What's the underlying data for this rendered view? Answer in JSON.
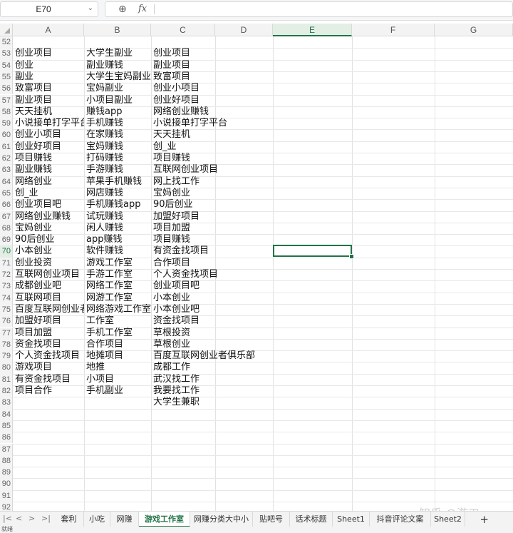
{
  "formula_bar": {
    "cell_reference": "E70",
    "fx_label": "fx",
    "formula_value": ""
  },
  "columns": [
    "A",
    "B",
    "C",
    "D",
    "E",
    "F",
    "G"
  ],
  "selected_column": "E",
  "selected_row": 70,
  "row_numbers": [
    52,
    53,
    54,
    55,
    56,
    57,
    58,
    59,
    60,
    61,
    62,
    63,
    64,
    65,
    66,
    67,
    68,
    69,
    70,
    71,
    72,
    73,
    74,
    75,
    76,
    77,
    78,
    79,
    80,
    81,
    82,
    83,
    84,
    85,
    86,
    87,
    88,
    89,
    90,
    91,
    92
  ],
  "rows": [
    {
      "row": 53,
      "a": "创业项目",
      "b": "大学生副业",
      "c": "创业项目"
    },
    {
      "row": 54,
      "a": "创业",
      "b": "副业赚钱",
      "c": "副业项目"
    },
    {
      "row": 55,
      "a": "副业",
      "b": "大学生宝妈副业",
      "c": "致富项目"
    },
    {
      "row": 56,
      "a": "致富项目",
      "b": "宝妈副业",
      "c": "创业小项目"
    },
    {
      "row": 57,
      "a": "副业项目",
      "b": "小项目副业",
      "c": "创业好项目"
    },
    {
      "row": 58,
      "a": "天天挂机",
      "b": "赚钱app",
      "c": "网络创业赚钱"
    },
    {
      "row": 59,
      "a": "小说接单打字平台",
      "b": "手机赚钱",
      "c": "小说接单打字平台"
    },
    {
      "row": 60,
      "a": "创业小项目",
      "b": "在家赚钱",
      "c": "天天挂机"
    },
    {
      "row": 61,
      "a": "创业好项目",
      "b": "宝妈赚钱",
      "c": "创_业"
    },
    {
      "row": 62,
      "a": "项目赚钱",
      "b": "打码赚钱",
      "c": "项目赚钱"
    },
    {
      "row": 63,
      "a": "副业赚钱",
      "b": "手游赚钱",
      "c": "互联网创业项目"
    },
    {
      "row": 64,
      "a": "网络创业",
      "b": "苹果手机赚钱",
      "c": "网上找工作"
    },
    {
      "row": 65,
      "a": "创_业",
      "b": "网店赚钱",
      "c": "宝妈创业"
    },
    {
      "row": 66,
      "a": "创业项目吧",
      "b": "手机赚钱app",
      "c": "90后创业"
    },
    {
      "row": 67,
      "a": "网络创业赚钱",
      "b": "试玩赚钱",
      "c": "加盟好项目"
    },
    {
      "row": 68,
      "a": "宝妈创业",
      "b": "闲人赚钱",
      "c": "项目加盟"
    },
    {
      "row": 69,
      "a": "90后创业",
      "b": "app赚钱",
      "c": "项目赚钱"
    },
    {
      "row": 70,
      "a": "小本创业",
      "b": "软件赚钱",
      "c": "有资金找项目"
    },
    {
      "row": 71,
      "a": "创业投资",
      "b": "游戏工作室",
      "c": "合作项目"
    },
    {
      "row": 72,
      "a": "互联网创业项目",
      "b": "手游工作室",
      "c": "个人资金找项目"
    },
    {
      "row": 73,
      "a": "成都创业吧",
      "b": "网络工作室",
      "c": "创业项目吧"
    },
    {
      "row": 74,
      "a": "互联网项目",
      "b": "网游工作室",
      "c": "小本创业"
    },
    {
      "row": 75,
      "a": "百度互联网创业者俱乐部",
      "b": "网络游戏工作室",
      "c": "小本创业吧"
    },
    {
      "row": 76,
      "a": "加盟好项目",
      "b": "工作室",
      "c": "资金找项目"
    },
    {
      "row": 77,
      "a": "项目加盟",
      "b": "手机工作室",
      "c": "草根投资"
    },
    {
      "row": 78,
      "a": "资金找项目",
      "b": "合作项目",
      "c": "草根创业"
    },
    {
      "row": 79,
      "a": "个人资金找项目",
      "b": "地摊项目",
      "c": "百度互联网创业者俱乐部"
    },
    {
      "row": 80,
      "a": "游戏项目",
      "b": "地推",
      "c": "成都工作"
    },
    {
      "row": 81,
      "a": "有资金找项目",
      "b": "小项目",
      "c": "武汉找工作"
    },
    {
      "row": 82,
      "a": "项目合作",
      "b": "手机副业",
      "c": "我要找工作"
    },
    {
      "row": 83,
      "a": "",
      "b": "",
      "c": "大学生兼职"
    }
  ],
  "sheet_tabs": [
    "套利",
    "小吃",
    "网赚",
    "游戏工作室",
    "网赚分类大中小",
    "贴吧号",
    "话术标题",
    "Sheet1",
    "抖音评论文案",
    "Sheet2"
  ],
  "active_tab": "游戏工作室",
  "add_tab_label": "+",
  "nav_buttons": [
    "|<",
    "<",
    ">",
    ">|"
  ],
  "status_text": "就绪",
  "watermark": "知乎 @游刃",
  "colors": {
    "accent": "#217346",
    "grid": "#e2e2e2",
    "header_bg": "#f3f3f3"
  },
  "icons": {
    "zoom": "zoom-icon",
    "dropdown": "chevron-down-icon"
  }
}
